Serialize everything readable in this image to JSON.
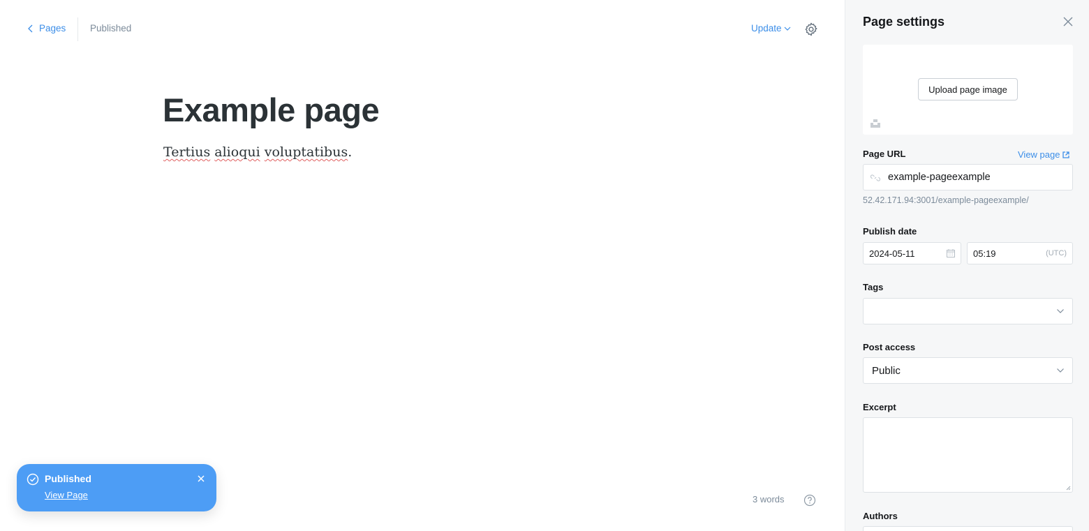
{
  "topbar": {
    "back_label": "Pages",
    "status": "Published",
    "update_label": "Update"
  },
  "editor": {
    "title": "Example page",
    "body_words": [
      "Tertius",
      "alioqui",
      "voluptatibus"
    ],
    "body_end": ".",
    "word_count": "3 words"
  },
  "toast": {
    "title": "Published",
    "link": "View Page"
  },
  "sidebar": {
    "title": "Page settings",
    "upload_label": "Upload page image",
    "url_label": "Page URL",
    "view_page_label": "View page",
    "url_value": "example-pageexample",
    "url_hint": "52.42.171.94:3001/example-pageexample/",
    "publish_date_label": "Publish date",
    "date_value": "2024-05-11",
    "time_value": "05:19",
    "timezone": "(UTC)",
    "tags_label": "Tags",
    "tags_value": "",
    "post_access_label": "Post access",
    "post_access_value": "Public",
    "excerpt_label": "Excerpt",
    "authors_label": "Authors"
  },
  "colors": {
    "accent": "#3c8ee8",
    "toast_bg": "#4d9df5",
    "sidebar_bg": "#f6f7f8"
  }
}
